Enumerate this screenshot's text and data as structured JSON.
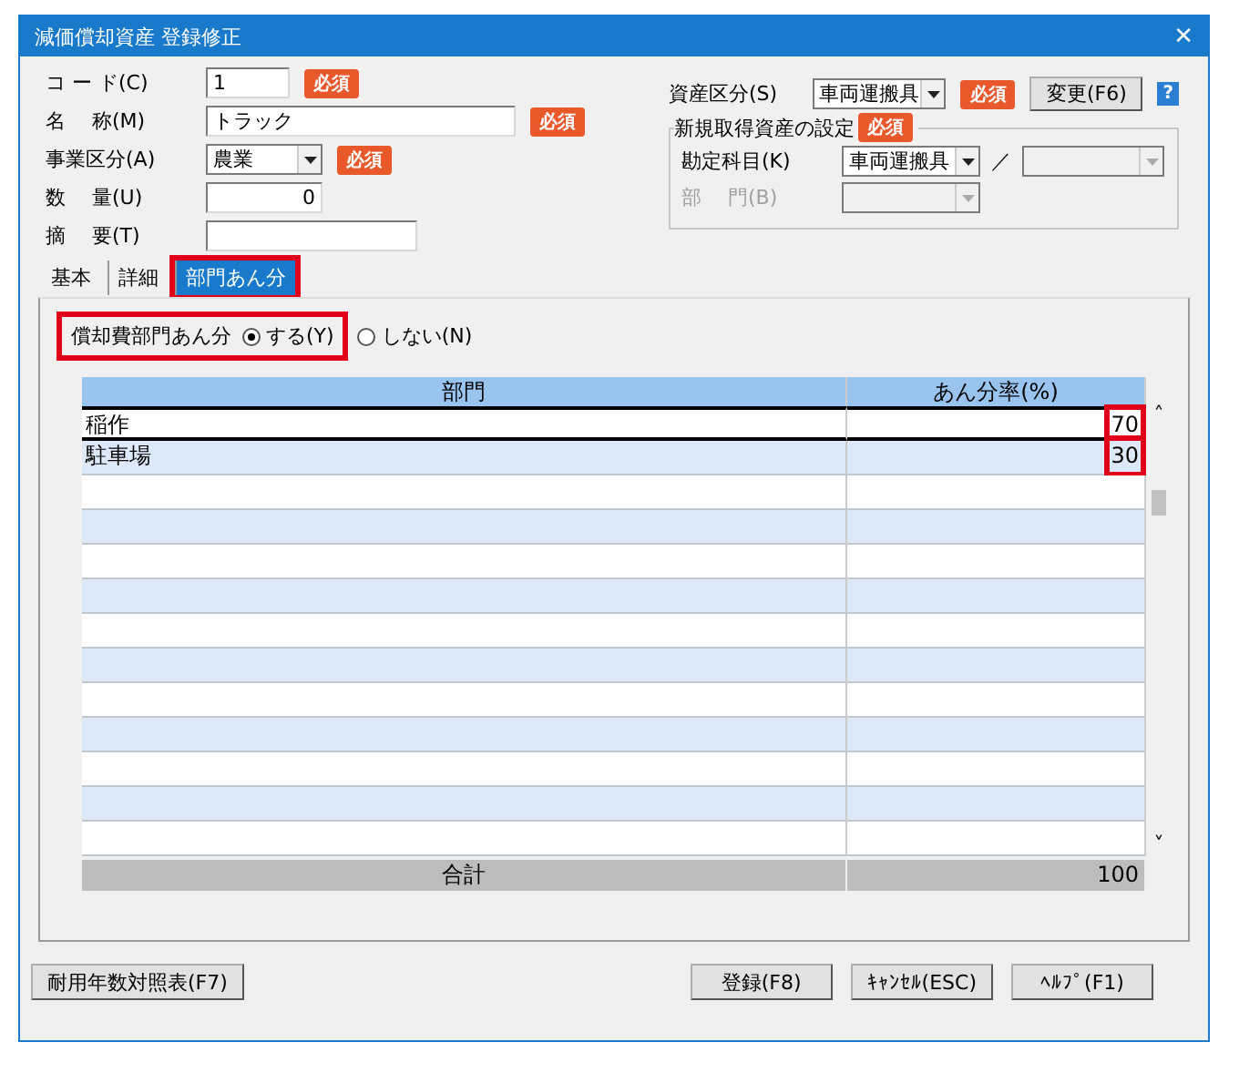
{
  "window": {
    "title": "減価償却資産 登録修正",
    "close": "✕"
  },
  "fields_left": [
    {
      "label": "コ ー ド(C)",
      "kind": "text",
      "value": "1",
      "required": "必須"
    },
    {
      "label": "名　 称(M)",
      "kind": "text",
      "value": "トラック",
      "required": "必須"
    },
    {
      "label": "事業区分(A)",
      "kind": "select",
      "value": "農業",
      "required": "必須"
    },
    {
      "label": "数　 量(U)",
      "kind": "text",
      "value": "0"
    },
    {
      "label": "摘　 要(T)",
      "kind": "text"
    }
  ],
  "asset_class": {
    "label": "資産区分(S)",
    "value": "車両運搬具",
    "required": "必須",
    "change_button": "変更(F6)",
    "help": "?"
  },
  "new_asset_group": {
    "title": "新規取得資産の設定",
    "required": "必須",
    "rows": [
      {
        "label": "勘定科目(K)",
        "value": "車両運搬具",
        "disabled": false,
        "separator": "／",
        "sub_disabled": true
      },
      {
        "label": "部　 門(B)",
        "disabled": true
      }
    ]
  },
  "tabs": [
    {
      "label": "基本",
      "selected": false,
      "highlighted": false
    },
    {
      "label": "詳細",
      "selected": false,
      "highlighted": false
    },
    {
      "label": "部門あん分",
      "selected": true,
      "highlighted": true
    }
  ],
  "allocation": {
    "label": "償却費部門あん分",
    "highlighted": true,
    "options": [
      {
        "label": "する(Y)",
        "selected": true
      },
      {
        "label": "しない(N)",
        "selected": false
      }
    ]
  },
  "table": {
    "columns": [
      "部門",
      "あん分率(%)"
    ],
    "rows": [
      {
        "dept": "稲作",
        "rate": "70",
        "selected": true,
        "highlighted": true
      },
      {
        "dept": "駐車場",
        "rate": "30",
        "selected": false,
        "highlighted": true
      }
    ],
    "total": {
      "label": "合計",
      "value": "100"
    },
    "scroll_up": "˄",
    "scroll_down": "˅"
  },
  "buttons_left": [
    "耐用年数対照表(F7)"
  ],
  "buttons_right": [
    "登録(F8)",
    "ｷｬﾝｾﾙ(ESC)",
    "ﾍﾙﾌﾟ(F1)"
  ]
}
